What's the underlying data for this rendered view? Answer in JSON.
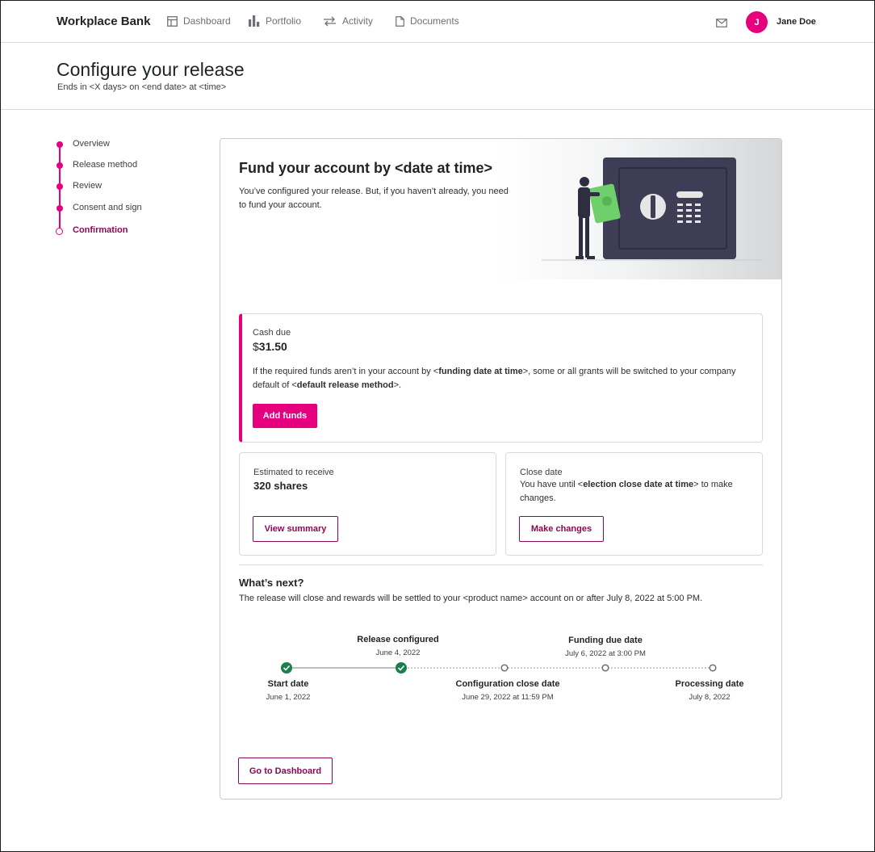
{
  "nav": {
    "brand": "Workplace Bank",
    "items": [
      {
        "label": "Dashboard",
        "icon": "layout-icon"
      },
      {
        "label": "Portfolio",
        "icon": "bar-chart-icon"
      },
      {
        "label": "Activity",
        "icon": "arrows-icon"
      },
      {
        "label": "Documents",
        "icon": "document-icon"
      }
    ],
    "avatar_initial": "J",
    "user_name": "Jane Doe"
  },
  "header": {
    "title": "Configure your release",
    "subtitle": "Ends in <X days> on <end date> at <time>"
  },
  "stepper": {
    "steps": [
      {
        "label": "Overview"
      },
      {
        "label": "Release method"
      },
      {
        "label": "Review"
      },
      {
        "label": "Consent and sign"
      },
      {
        "label": "Confirmation"
      }
    ]
  },
  "hero": {
    "title": "Fund your account by <date at time>",
    "text": "You’ve configured your release. But, if you haven’t already, you need to fund your account."
  },
  "cash": {
    "label": "Cash due",
    "currency": "$",
    "amount": "31.50",
    "text_1": "If the required funds aren’t in your account by <",
    "text_bold_1": "funding date at time",
    "text_2": ">, some or all grants will be switched to your company default of <",
    "text_bold_2": "default release method",
    "text_3": ">.",
    "button": "Add funds"
  },
  "estimate": {
    "label": "Estimated to receive",
    "value": "320 shares",
    "button": "View summary"
  },
  "close": {
    "label": "Close date",
    "text_1": "You have until <",
    "text_bold": "election close date at time",
    "text_2": "> to make changes.",
    "button": "Make changes"
  },
  "next": {
    "title": "What’s next?",
    "text": "The release will close and rewards will be settled to your <product name> account on or after July 8, 2022 at 5:00 PM."
  },
  "timeline": [
    {
      "label": "Start date",
      "date": "June 1, 2022",
      "done": true
    },
    {
      "label": "Release configured",
      "date": "June 4, 2022",
      "done": true
    },
    {
      "label": "Configuration close date",
      "date": "June 29, 2022 at 11:59 PM",
      "done": false
    },
    {
      "label": "Funding due date",
      "date": "July 6, 2022 at 3:00 PM",
      "done": false
    },
    {
      "label": "Processing date",
      "date": "July 8, 2022",
      "done": false
    }
  ],
  "footer": {
    "button": "Go to Dashboard"
  },
  "colors": {
    "accent": "#e6007e",
    "accent_dark": "#8a0a52",
    "success": "#1a7f4b"
  }
}
